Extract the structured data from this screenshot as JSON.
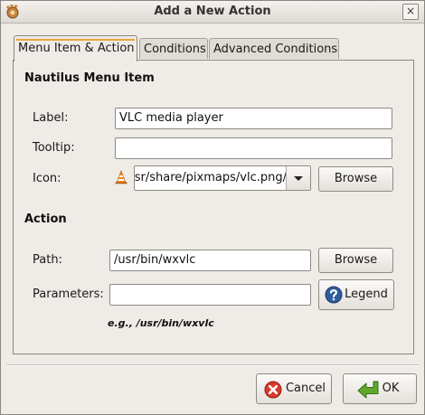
{
  "window": {
    "title": "Add a New Action",
    "close_symbol": "×"
  },
  "tabs": [
    {
      "label": "Menu Item & Action",
      "active": true
    },
    {
      "label": "Conditions",
      "active": false
    },
    {
      "label": "Advanced Conditions",
      "active": false
    }
  ],
  "menu_item": {
    "section_title": "Nautilus Menu Item",
    "label_label": "Label:",
    "label_value": "VLC media player",
    "tooltip_label": "Tooltip:",
    "tooltip_value": "",
    "icon_label": "Icon:",
    "icon_value": "/usr/share/pixmaps/vlc.png",
    "icon_glyph": "vlc-cone-icon",
    "browse_label": "Browse"
  },
  "action": {
    "section_title": "Action",
    "path_label": "Path:",
    "path_value": "/usr/bin/wxvlc",
    "path_browse_label": "Browse",
    "parameters_label": "Parameters:",
    "parameters_value": "",
    "legend_label": "Legend",
    "hint": "e.g., /usr/bin/wxvlc"
  },
  "buttons": {
    "cancel_label": "Cancel",
    "ok_label": "OK"
  },
  "colors": {
    "background": "#efebe7",
    "tab_accent": "#e8a53b",
    "cancel_icon": "#d63a2a",
    "ok_icon": "#5ea82c",
    "help_icon": "#2e5c9c"
  }
}
